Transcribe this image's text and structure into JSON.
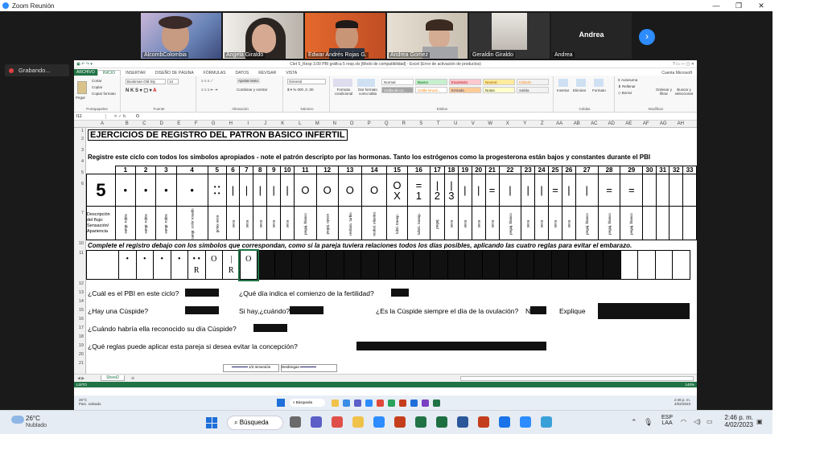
{
  "zoom": {
    "title": "Zoom Reunión",
    "recording_label": "Grabando...",
    "participants": [
      {
        "name": "AlcombColombia"
      },
      {
        "name": "Angela Giraldo"
      },
      {
        "name": "Edwar Andrés Rojas G."
      },
      {
        "name": "Andrea Gomez"
      },
      {
        "name": "Geraldin Giraldo"
      },
      {
        "name": "Andrea"
      }
    ],
    "andrea_big_label": "Andrea",
    "next_icon": "chevron-right-icon"
  },
  "excel": {
    "window_title": "Clet 5_Resp 3.00 PBI gráfica 5 resp.xls [Modo de compatibilidad] - Excel (Error de activación de productos)",
    "account": "Cuenta Microsoft",
    "tabs": [
      "ARCHIVO",
      "INICIO",
      "INSERTAR",
      "DISEÑO DE PÁGINA",
      "FÓRMULAS",
      "DATOS",
      "REVISAR",
      "VISTA"
    ],
    "ribbon": {
      "paste": "Pegar",
      "cut": "Cortar",
      "copy": "Copiar",
      "format_painter": "Copiar formato",
      "clipboard_group": "Portapapeles",
      "font_name": "Bookman Old Sty",
      "font_size": "14",
      "font_group": "Fuente",
      "wrap": "Ajustar texto",
      "merge": "Combinar y centrar",
      "align_group": "Alineación",
      "number_format": "General",
      "number_group": "Número",
      "cond_format": "Formato condicional",
      "format_table": "Dar formato como tabla",
      "styles": [
        "Normal",
        "Bueno",
        "Incorrecto",
        "Neutral",
        "Cálculo",
        "Celda de co...",
        "Celda vincul...",
        "Entrada",
        "Notas",
        "Salida"
      ],
      "styles_group": "Estilos",
      "insert": "Insertar",
      "delete": "Eliminar",
      "format": "Formato",
      "cells_group": "Celdas",
      "autosum": "Autosuma",
      "fill": "Rellenar",
      "clear": "Borrar",
      "sort": "Ordenar y filtrar",
      "find": "Buscar y seleccionar",
      "modify_group": "Modificar"
    },
    "name_box": "I11",
    "formula_value": "O",
    "columns": [
      "A",
      "B",
      "C",
      "D",
      "E",
      "F",
      "G",
      "H",
      "I",
      "J",
      "K",
      "L",
      "M",
      "N",
      "O",
      "P",
      "Q",
      "R",
      "S",
      "T",
      "U",
      "V",
      "W",
      "X",
      "Y",
      "Z",
      "AA",
      "AB",
      "AC",
      "AD",
      "AE",
      "AF",
      "AG",
      "AH"
    ],
    "rows": [
      "1",
      "2",
      "3",
      "4",
      "5",
      "6",
      "7",
      "10",
      "11",
      "12",
      "13",
      "14",
      "15",
      "16",
      "17",
      "18",
      "19",
      "20",
      "21"
    ],
    "sheet": {
      "heading": "EJERCICIOS DE REGISTRO DEL PATRON BASICO INFERTIL",
      "instruction": "Registre este ciclo con todos los simbolos apropiados - note el patrón descripto por las hormonas. Tanto los estrógenos como la progesterona están bajos y constantes durante el PBI",
      "cycle_number": "5",
      "day_numbers": [
        "1",
        "2",
        "3",
        "4",
        "5",
        "6",
        "7",
        "8",
        "9",
        "10",
        "11",
        "12",
        "13",
        "14",
        "15",
        "16",
        "17",
        "18",
        "19",
        "20",
        "21",
        "22",
        "23",
        "24",
        "25",
        "26",
        "27",
        "28",
        "29",
        "30",
        "31",
        "32",
        "33"
      ],
      "symbols_row": [
        "•",
        "•",
        "•",
        "•",
        "• •\n• •",
        "|",
        "|",
        "|",
        "|",
        "|",
        "O",
        "O",
        "O",
        "O",
        "O",
        "=",
        "|",
        "|",
        "|",
        "|",
        "=",
        "|",
        "|",
        "|",
        "=",
        "|",
        "|",
        "=",
        "=",
        "",
        "",
        "",
        ""
      ],
      "peak_row": [
        "",
        "",
        "",
        "",
        "",
        "",
        "",
        "",
        "",
        "",
        "",
        "",
        "",
        "",
        "X",
        "1",
        "2",
        "3",
        "",
        "",
        "",
        "",
        "",
        "",
        "",
        "",
        "",
        "",
        "",
        "",
        "",
        "",
        ""
      ],
      "label_desc": "Descripción del flujo: Sensación/ Apariencia",
      "descriptions": [
        "sangr. rojiza",
        "sangr. rojiza",
        "sangr. rojiza",
        "sangr. color rosado",
        "gotas seca",
        "seca",
        "seca",
        "seca",
        "seca",
        "seca",
        "pegaj. blanco",
        "pegaj. opaco",
        "resbalo. turbio",
        "resbal. elástico",
        "lubri. transp.",
        "lubric. transp.",
        "pegaj.",
        "seca",
        "seca",
        "seca",
        "seca",
        "pegaj. blanco",
        "seca",
        "seca",
        "seca",
        "seca",
        "pegaj. blanco",
        "pegaj. blanco",
        "pegaj. blanco",
        "",
        "",
        "",
        ""
      ],
      "instruction2": "Complete el registro debajo con los simbolos que correspondan, como si la pareja tuviera relaciones todos los dias posibles, aplicando las cuatro reglas para evitar el embarazo.",
      "answer_row": [
        "•",
        "•",
        "•",
        "•",
        "• •",
        "O",
        "|",
        "O"
      ],
      "answer_marks": [
        "",
        "",
        "",
        "",
        "R",
        "",
        "R",
        ""
      ],
      "q13a": "¿Cuál es el PBI en este ciclo?",
      "q13b": "¿Qué día indica el comienzo de la fertilidad?",
      "q15a": "¿Hay una Cúspide?",
      "q15b": "Si hay,¿cuándo?",
      "q15c": "¿Es la Cúspide siempre el día de la ovulación?",
      "q15c_ans": "N",
      "q15d": "Explique",
      "q17": "¿Cuándo habría ella reconocido su día Cúspide?",
      "q19": "¿Qué reglas puede aplicar esta pareja si desea evitar la concepción?",
      "legend1": "1/3 Inmersión",
      "legend2": "Desbregan"
    },
    "sheet_tab": "Sheet2",
    "status_left": "LISTO",
    "zoom_pct": "140%"
  },
  "inner_taskbar": {
    "weather_temp": "26°C",
    "weather_desc": "Parc. soleado",
    "search": "Búsqueda",
    "time": "2:46 p. m.",
    "date": "4/02/2023"
  },
  "taskbar": {
    "weather_temp": "26°C",
    "weather_desc": "Nublado",
    "search": "Búsqueda",
    "lang1": "ESP",
    "lang2": "LAA",
    "time": "2:46 p. m.",
    "date": "4/02/2023"
  }
}
